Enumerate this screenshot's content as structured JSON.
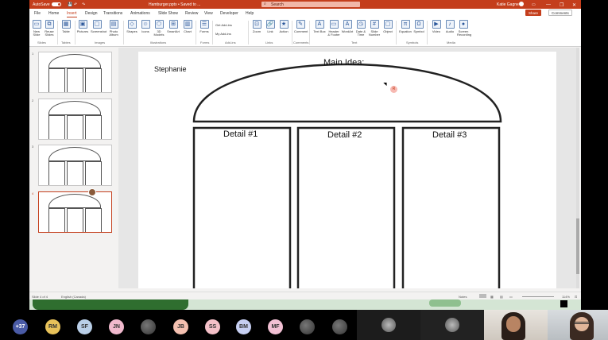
{
  "titlebar": {
    "autosave": "AutoSave",
    "filename": "Hamburger.pptx • Saved to ...",
    "search_placeholder": "Search",
    "user": "Katie Gagne",
    "window_controls": [
      "—",
      "❐",
      "✕"
    ]
  },
  "menu": {
    "tabs": [
      "File",
      "Home",
      "Insert",
      "Design",
      "Transitions",
      "Animations",
      "Slide Show",
      "Review",
      "View",
      "Developer",
      "Help"
    ],
    "active_tab": "Insert",
    "share_label": "Share",
    "comments_label": "Comments"
  },
  "ribbon": {
    "buttons": [
      "New Slide",
      "Reuse Slides",
      "Table",
      "Pictures",
      "Screenshot",
      "Photo Album",
      "Shapes",
      "Icons",
      "3D Models",
      "SmartArt",
      "Chart",
      "Forms",
      "Zoom",
      "Link",
      "Action",
      "Comment",
      "Text Box",
      "Header & Footer",
      "WordArt",
      "Date & Time",
      "Slide Number",
      "Object",
      "Equation",
      "Symbol",
      "Video",
      "Audio",
      "Screen Recording"
    ],
    "small_buttons": [
      "Get Add-ins",
      "My Add-ins"
    ],
    "groups": [
      "Slides",
      "Tables",
      "Images",
      "Illustrations",
      "Forms",
      "Add-ins",
      "Links",
      "Comments",
      "Text",
      "Symbols",
      "Media"
    ]
  },
  "thumbnails": {
    "numbers": [
      "1",
      "2",
      "3",
      "4"
    ],
    "selected": 4
  },
  "slide": {
    "student_name": "Stephanie",
    "main_idea_label": "Main Idea:",
    "detail1_label": "Detail #1",
    "detail2_label": "Detail #2",
    "detail3_label": "Detail #3"
  },
  "statusbar": {
    "slide_info": "Slide 4 of 4",
    "autosave_note": "English (Canada)",
    "notes_label": "Notes",
    "zoom": "114%"
  },
  "participants": {
    "overflow": "+37",
    "initials": [
      "RM",
      "SF",
      "JN",
      "JB",
      "SS",
      "BM",
      "MF"
    ],
    "colors": {
      "overflow": "#4a5ba6",
      "RM": "#e8c25a",
      "SF": "#b9cfe8",
      "JN": "#f0b9cd",
      "JB": "#f4c0b0",
      "SS": "#f4c0c8",
      "BM": "#c6cff2",
      "MF": "#f2c0d4"
    }
  },
  "colors": {
    "accent": "#c43e1c",
    "slide_outline": "#222222"
  }
}
